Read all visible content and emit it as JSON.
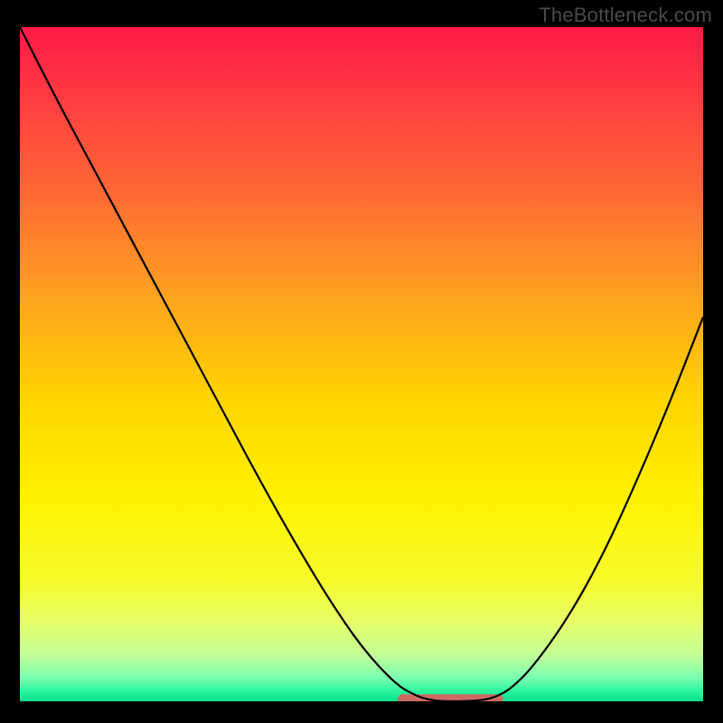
{
  "watermark": "TheBottleneck.com",
  "chart_data": {
    "type": "line",
    "title": "",
    "xlabel": "",
    "ylabel": "",
    "xlim": [
      0,
      100
    ],
    "ylim": [
      0,
      100
    ],
    "series": [
      {
        "name": "curve",
        "x": [
          0,
          5,
          10,
          15,
          20,
          25,
          30,
          35,
          40,
          45,
          50,
          55,
          58,
          60,
          62,
          65,
          68,
          70,
          72,
          75,
          80,
          85,
          90,
          95,
          100
        ],
        "y": [
          100,
          90,
          80.5,
          71,
          61.5,
          52,
          42.5,
          33,
          24,
          15.5,
          8,
          2.5,
          0.8,
          0.2,
          0,
          0,
          0.2,
          0.8,
          2,
          5,
          12,
          21,
          32,
          44,
          57
        ]
      },
      {
        "name": "minimum-band",
        "x": [
          56,
          70
        ],
        "y": [
          0.3,
          0.3
        ]
      }
    ],
    "gradient_stops": [
      {
        "offset": 0.0,
        "color": "#ff1a47"
      },
      {
        "offset": 0.1,
        "color": "#ff3a42"
      },
      {
        "offset": 0.25,
        "color": "#ff6a34"
      },
      {
        "offset": 0.4,
        "color": "#ffa320"
      },
      {
        "offset": 0.55,
        "color": "#ffd400"
      },
      {
        "offset": 0.7,
        "color": "#fff200"
      },
      {
        "offset": 0.82,
        "color": "#f6fb2a"
      },
      {
        "offset": 0.88,
        "color": "#e8fd66"
      },
      {
        "offset": 0.93,
        "color": "#c4ff95"
      },
      {
        "offset": 0.965,
        "color": "#7bffb0"
      },
      {
        "offset": 0.985,
        "color": "#2cf59f"
      },
      {
        "offset": 1.0,
        "color": "#07e08a"
      }
    ],
    "colors": {
      "curve": "#000000",
      "minimum_band": "#cf6a63",
      "background_frame": "#000000"
    }
  }
}
